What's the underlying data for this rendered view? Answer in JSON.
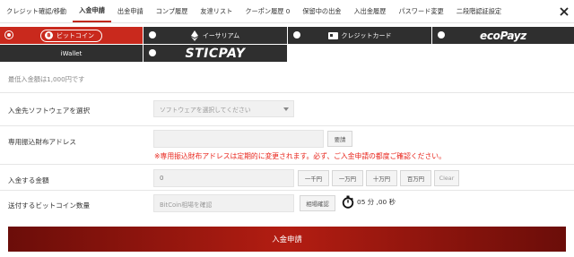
{
  "nav": {
    "tabs": [
      {
        "label": "クレジット確認/移動"
      },
      {
        "label": "入金申請"
      },
      {
        "label": "出金申請"
      },
      {
        "label": "コンプ履歴"
      },
      {
        "label": "友達リスト"
      },
      {
        "label": "クーポン履歴 0"
      },
      {
        "label": "保留中の出金"
      },
      {
        "label": "入出金履歴"
      },
      {
        "label": "パスワード変更"
      },
      {
        "label": "二段階認証設定"
      }
    ],
    "active_index": 1
  },
  "methods": {
    "bitcoin": "ビットコイン",
    "bitcoin_symbol": "฿",
    "ethereum": "イーサリアム",
    "credit_card": "クレジットカード",
    "ecopayz": "ecoPayz",
    "iwallet": "iWallet",
    "sticpay": "STICPAY"
  },
  "form": {
    "min_note": "最低入金額は1,000円です",
    "software_label": "入金先ソフトウェアを選択",
    "software_placeholder": "ソフトウェアを選択してください",
    "address_label": "専用振込財布アドレス",
    "address_request_button": "要請",
    "address_warning": "※専用振込財布アドレスは定期的に変更されます。必ず、ご入金申請の都度ご確認ください。",
    "amount_label": "入金する金額",
    "amount_value": "0",
    "amount_buttons": [
      "一千円",
      "一万円",
      "十万円",
      "百万円",
      "Clear"
    ],
    "btc_label": "送付するビットコイン数量",
    "btc_placeholder": "BitCoin相場を確認",
    "rate_button": "相場確認",
    "timer_text": "05 分 ,00 秒",
    "submit": "入金申請"
  },
  "colors": {
    "accent": "#c9291d",
    "dark_tile": "#2f2f2f",
    "warning": "#e8231a"
  }
}
